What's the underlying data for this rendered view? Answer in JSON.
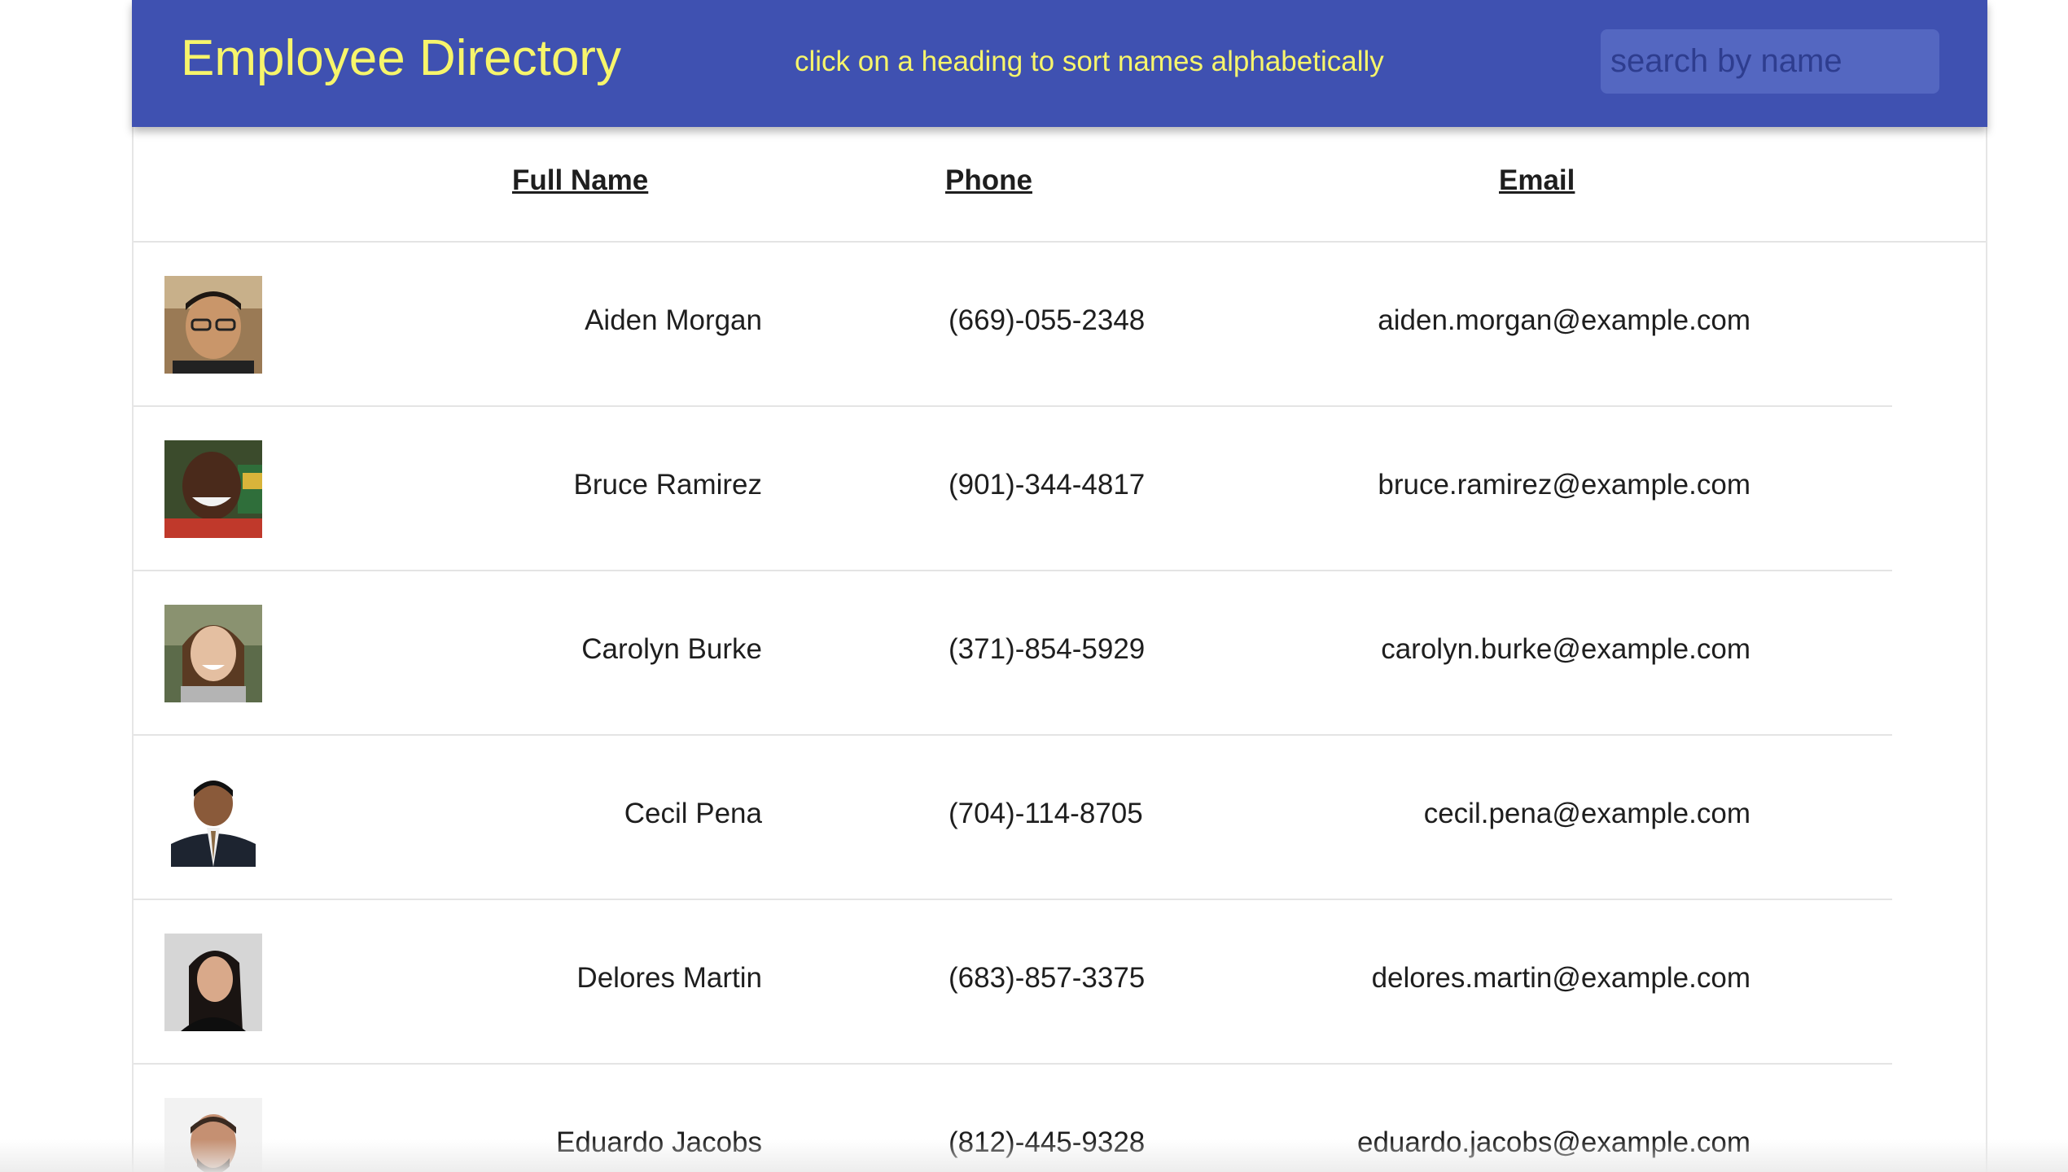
{
  "header": {
    "title": "Employee Directory",
    "instructions": "click on a heading to sort names alphabetically",
    "search_placeholder": "search by name",
    "background_color": "#3f51b1",
    "text_color": "#f7f56b"
  },
  "table": {
    "columns": [
      "Full Name",
      "Phone",
      "Email"
    ],
    "rows": [
      {
        "name": "Aiden Morgan",
        "phone": "(669)-055-2348",
        "email": "aiden.morgan@example.com",
        "avatar_icon": "avatar-photo"
      },
      {
        "name": "Bruce Ramirez",
        "phone": "(901)-344-4817",
        "email": "bruce.ramirez@example.com",
        "avatar_icon": "avatar-photo"
      },
      {
        "name": "Carolyn Burke",
        "phone": "(371)-854-5929",
        "email": "carolyn.burke@example.com",
        "avatar_icon": "avatar-photo"
      },
      {
        "name": "Cecil Pena",
        "phone": "(704)-114-8705",
        "email": "cecil.pena@example.com",
        "avatar_icon": "avatar-photo"
      },
      {
        "name": "Delores Martin",
        "phone": "(683)-857-3375",
        "email": "delores.martin@example.com",
        "avatar_icon": "avatar-photo"
      },
      {
        "name": "Eduardo Jacobs",
        "phone": "(812)-445-9328",
        "email": "eduardo.jacobs@example.com",
        "avatar_icon": "avatar-photo"
      }
    ]
  }
}
